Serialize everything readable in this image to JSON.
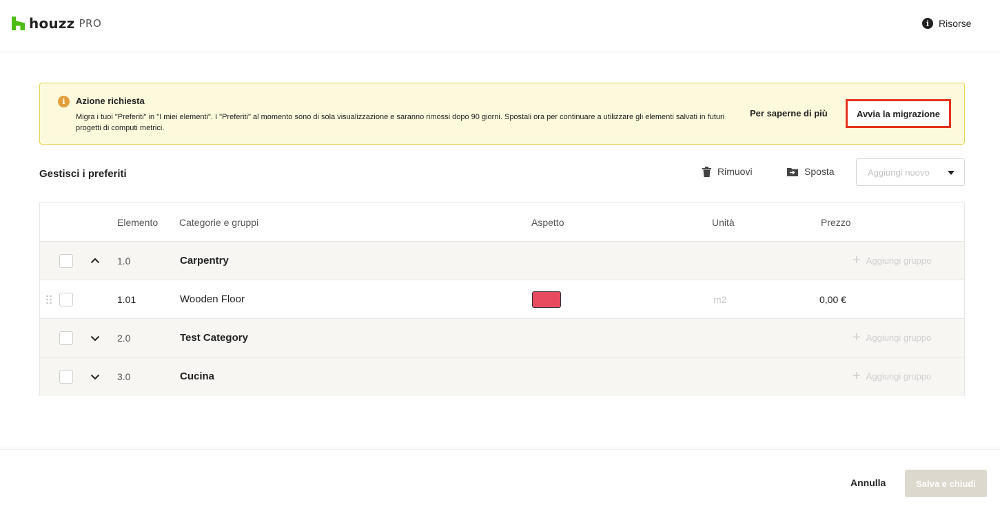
{
  "header": {
    "logo_word": "houzz",
    "logo_pro": "PRO",
    "resources_label": "Risorse"
  },
  "banner": {
    "title": "Azione richiesta",
    "message": "Migra i tuoi \"Preferiti\" in \"I miei elementi\". I \"Preferiti\" al momento sono di sola visualizzazione e saranno rimossi dopo 90 giorni. Spostali ora per continuare a utilizzare gli elementi salvati in futuri progetti di computi metrici.",
    "learn_more": "Per saperne di più",
    "migrate_button": "Avvia la migrazione"
  },
  "toolbar": {
    "title": "Gestisci i preferiti",
    "remove": "Rimuovi",
    "move": "Sposta",
    "add_new": "Aggiungi nuovo"
  },
  "table": {
    "headers": {
      "element": "Elemento",
      "categories": "Categorie e gruppi",
      "aspect": "Aspetto",
      "unit": "Unità",
      "price": "Prezzo"
    },
    "rows": [
      {
        "type": "group",
        "number": "1.0",
        "name": "Carpentry",
        "expanded": true,
        "add_group": "Aggiungi gruppo"
      },
      {
        "type": "item",
        "number": "1.01",
        "name": "Wooden Floor",
        "swatch_color": "#e84a5f",
        "unit": "m2",
        "price": "0,00 €"
      },
      {
        "type": "group",
        "number": "2.0",
        "name": "Test Category",
        "expanded": false,
        "add_group": "Aggiungi gruppo"
      },
      {
        "type": "group",
        "number": "3.0",
        "name": "Cucina",
        "expanded": false,
        "add_group": "Aggiungi gruppo"
      }
    ]
  },
  "footer": {
    "cancel": "Annulla",
    "save": "Salva e chiudi"
  },
  "colors": {
    "brand_green": "#4dbc15",
    "banner_bg": "#fdf9dc",
    "highlight_red": "#e4321b",
    "warn_orange": "#e29f3c"
  }
}
